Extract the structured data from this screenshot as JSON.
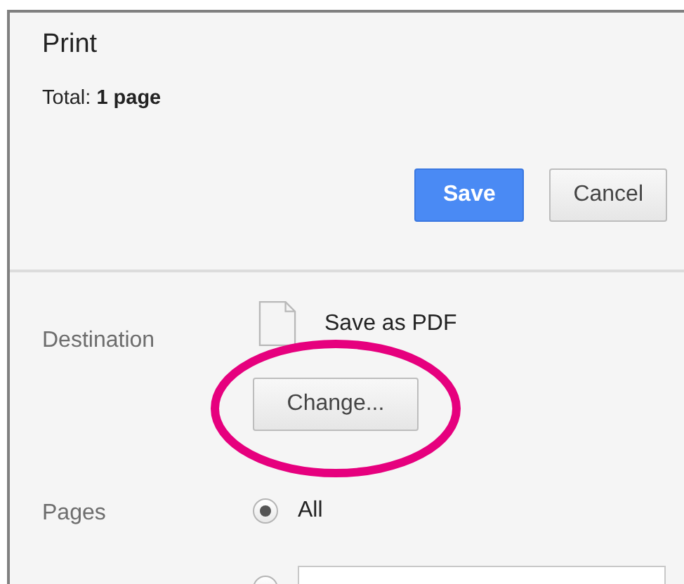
{
  "dialog": {
    "title": "Print",
    "summary": "Total: **1 page**"
  },
  "buttons": [
    {
      "label": "Save",
      "kind": "primary"
    },
    {
      "label": "Cancel",
      "kind": "secondary"
    }
  ],
  "destination": {
    "label": "Destination",
    "printer": "Save as PDF",
    "change_button": "Change..."
  },
  "annotation": {
    "kind": "ellipse",
    "color": "#e6007e"
  },
  "pages": {
    "label": "Pages",
    "options": [
      {
        "kind": "radio",
        "label": "All",
        "selected": true
      },
      {
        "kind": "range",
        "selected": false
      }
    ]
  }
}
